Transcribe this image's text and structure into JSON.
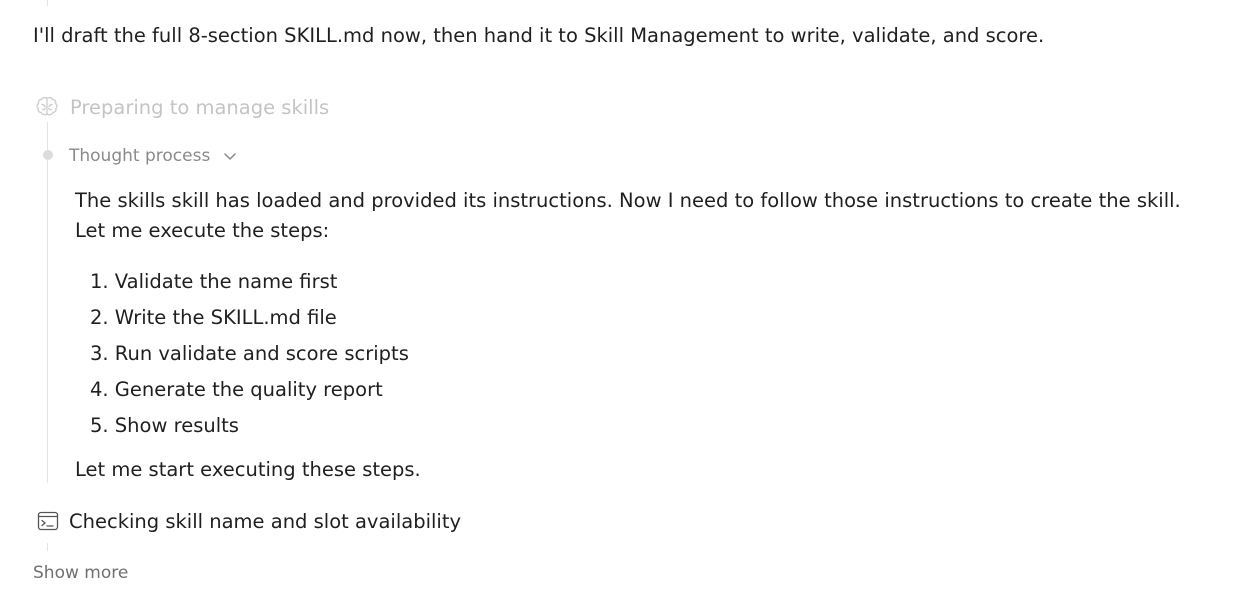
{
  "message": {
    "intro": "I'll draft the full 8-section SKILL.md now, then hand it to Skill Management to write, validate, and score."
  },
  "step": {
    "label": "Preparing to manage skills",
    "icon": "brain-icon"
  },
  "thought": {
    "toggle_label": "Thought process",
    "paragraph": "The skills skill has loaded and provided its instructions. Now I need to follow those instructions to create the skill. Let me execute the steps:",
    "steps": [
      "1. Validate the name first",
      "2. Write the SKILL.md file",
      "3. Run validate and score scripts",
      "4. Generate the quality report",
      "5. Show results"
    ],
    "closing": "Let me start executing these steps."
  },
  "tool": {
    "label": "Checking skill name and slot availability",
    "icon": "terminal-icon"
  },
  "footer": {
    "show_more": "Show more"
  }
}
